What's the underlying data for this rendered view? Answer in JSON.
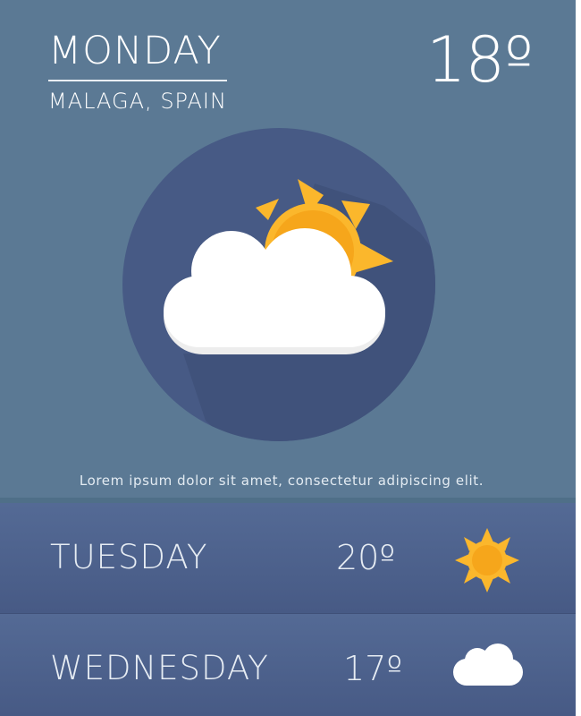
{
  "today": {
    "day": "MONDAY",
    "location": "MALAGA, SPAIN",
    "temperature": "18º",
    "icon": "partly-cloudy-icon",
    "description": "Lorem ipsum dolor sit amet, consectetur adipiscing elit."
  },
  "forecast": [
    {
      "day": "TUESDAY",
      "temperature": "20º",
      "icon": "sun-icon"
    },
    {
      "day": "WEDNESDAY",
      "temperature": "17º",
      "icon": "cloud-icon"
    }
  ],
  "colors": {
    "background": "#5b7994",
    "circle": "#475a85",
    "sun": "#fbb72c",
    "sun_core": "#f6a61b",
    "cloud": "#ffffff",
    "row": "#4b5e89"
  }
}
